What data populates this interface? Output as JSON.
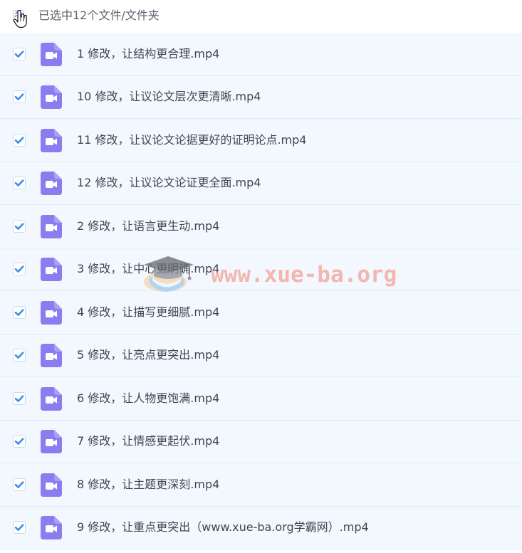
{
  "header": {
    "selection_text": "已选中12个文件/文件夹",
    "checkbox_state": "partially-covered-by-cursor"
  },
  "files": [
    {
      "name": "1 修改，让结构更合理.mp4",
      "checked": true,
      "icon": "video-file-icon"
    },
    {
      "name": "10 修改，让议论文层次更清晰.mp4",
      "checked": true,
      "icon": "video-file-icon"
    },
    {
      "name": "11 修改，让议论文论据更好的证明论点.mp4",
      "checked": true,
      "icon": "video-file-icon"
    },
    {
      "name": "12 修改，让议论文论证更全面.mp4",
      "checked": true,
      "icon": "video-file-icon"
    },
    {
      "name": "2 修改，让语言更生动.mp4",
      "checked": true,
      "icon": "video-file-icon"
    },
    {
      "name": "3 修改，让中心更明确.mp4",
      "checked": true,
      "icon": "video-file-icon"
    },
    {
      "name": "4 修改，让描写更细腻.mp4",
      "checked": true,
      "icon": "video-file-icon"
    },
    {
      "name": "5 修改，让亮点更突出.mp4",
      "checked": true,
      "icon": "video-file-icon"
    },
    {
      "name": "6 修改，让人物更饱满.mp4",
      "checked": true,
      "icon": "video-file-icon"
    },
    {
      "name": "7 修改，让情感更起伏.mp4",
      "checked": true,
      "icon": "video-file-icon"
    },
    {
      "name": "8 修改，让主题更深刻.mp4",
      "checked": true,
      "icon": "video-file-icon"
    },
    {
      "name": "9 修改，让重点更突出（www.xue-ba.org学霸网）.mp4",
      "checked": true,
      "icon": "video-file-icon"
    }
  ],
  "watermark": {
    "text": "www.xue-ba.org",
    "logo_icon": "graduation-cap-book-icon"
  },
  "colors": {
    "checkbox_accent": "#3b8eea",
    "file_icon": "#8b7cf0",
    "row_background": "#f3f8fe",
    "row_divider": "#dcebfa",
    "text": "#3e4652",
    "watermark": "#f0826e"
  }
}
